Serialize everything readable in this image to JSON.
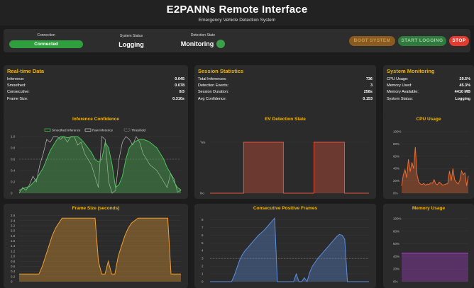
{
  "header": {
    "title": "E2PANNs Remote Interface",
    "subtitle": "Emergency Vehicle Detection System"
  },
  "topbar": {
    "connection_label": "Connection",
    "connection_value": "Connected",
    "system_status_label": "System Status",
    "system_status_value": "Logging",
    "detection_state_label": "Detection State",
    "detection_state_value": "Monitoring",
    "boot_label": "BOOT SYSTEM",
    "start_logging_label": "START LOGGING",
    "stop_label": "STOP"
  },
  "realtime": {
    "title": "Real-time Data",
    "rows": [
      {
        "label": "Inference:",
        "value": "0.045"
      },
      {
        "label": "Smoothed:",
        "value": "0.078"
      },
      {
        "label": "Consecutive:",
        "value": "0/3"
      },
      {
        "label": "Frame Size:",
        "value": "0.310s"
      }
    ]
  },
  "session": {
    "title": "Session Statistics",
    "rows": [
      {
        "label": "Total Inferences:",
        "value": "736"
      },
      {
        "label": "Detection Events:",
        "value": "3"
      },
      {
        "label": "Session Duration:",
        "value": "258s"
      },
      {
        "label": "Avg Confidence:",
        "value": "0.153"
      }
    ]
  },
  "system": {
    "title": "System Monitoring",
    "rows": [
      {
        "label": "CPU Usage:",
        "value": "29.5%"
      },
      {
        "label": "Memory Used:",
        "value": "45.3%"
      },
      {
        "label": "Memory Available:",
        "value": "4410 MB"
      },
      {
        "label": "System Status:",
        "value": "Logging"
      }
    ]
  },
  "colors": {
    "accent": "#f0b400",
    "green": "#3aa04a",
    "stop": "#e53b2e",
    "ev": "#e5533c",
    "frame": "#f0a030",
    "consec": "#5b8de0",
    "memory": "#b040d0",
    "cpu": "#ee6a2e"
  },
  "chart_data": [
    {
      "type": "line",
      "title": "Inference Confidence",
      "yticks": [
        "0",
        "0.2",
        "0.4",
        "0.6",
        "0.8",
        "1.0"
      ],
      "ylim": [
        0,
        1.05
      ],
      "threshold": 0.6,
      "series": [
        {
          "name": "Smoothed Inference",
          "values": [
            0.05,
            0.08,
            0.1,
            0.12,
            0.18,
            0.25,
            0.35,
            0.45,
            0.6,
            0.75,
            0.85,
            0.95,
            1.0,
            1.0,
            0.98,
            0.99,
            1.0,
            1.0,
            0.95,
            0.88,
            0.8,
            0.72,
            0.6,
            0.55,
            0.6,
            0.9,
            0.8,
            0.5,
            0.1,
            0.15,
            0.3,
            0.6,
            0.8,
            0.88,
            0.92,
            0.95,
            0.95,
            0.93,
            0.9,
            0.85,
            0.8,
            0.7,
            0.6,
            0.45,
            0.35,
            0.2,
            0.1,
            0.06
          ]
        },
        {
          "name": "Raw Inference",
          "values": [
            0.0,
            0.1,
            0.05,
            0.15,
            0.3,
            0.2,
            0.5,
            0.7,
            0.95,
            0.9,
            1.0,
            1.0,
            0.95,
            1.0,
            0.9,
            1.0,
            1.0,
            0.85,
            0.9,
            0.7,
            0.6,
            0.5,
            0.3,
            0.1,
            1.0,
            0.95,
            0.2,
            0.0,
            0.05,
            0.6,
            0.9,
            1.0,
            0.95,
            0.85,
            1.0,
            0.9,
            0.7,
            0.6,
            0.5,
            0.45,
            0.4,
            0.3,
            0.2,
            0.1,
            0.35,
            0.25,
            0.02,
            0.05
          ]
        },
        {
          "name": "Threshold",
          "values": []
        }
      ]
    },
    {
      "type": "area",
      "title": "EV Detection State",
      "yticks": [
        "No",
        "Yes"
      ],
      "values": [
        0,
        0,
        0,
        0,
        0,
        0,
        0,
        0,
        0,
        0,
        0,
        1,
        1,
        1,
        1,
        1,
        1,
        1,
        1,
        1,
        1,
        1,
        1,
        1,
        0,
        0,
        0,
        0,
        0,
        0,
        0,
        0,
        0,
        0,
        1,
        1,
        1,
        1,
        1,
        1,
        1,
        1,
        1,
        1,
        0,
        0,
        0,
        0,
        0,
        0,
        0,
        0,
        0
      ]
    },
    {
      "type": "area",
      "title": "CPU Usage",
      "yticks": [
        "0%",
        "20%",
        "40%",
        "60%",
        "80%",
        "100%"
      ],
      "ylim": [
        0,
        100
      ],
      "values": [
        12,
        30,
        38,
        25,
        55,
        35,
        50,
        40,
        75,
        30,
        18,
        15,
        14,
        16,
        13,
        15,
        14,
        17,
        16,
        22,
        15,
        14,
        18,
        16,
        13,
        14,
        15,
        16,
        36,
        20,
        40,
        22,
        18,
        15,
        20,
        36,
        30,
        33,
        12,
        28
      ]
    },
    {
      "type": "area",
      "title": "Frame Size (seconds)",
      "yticks": [
        "0",
        "0.2",
        "0.4",
        "0.6",
        "0.8",
        "1.0",
        "1.2",
        "1.4",
        "1.6",
        "1.8",
        "2.0",
        "2.2",
        "2.4",
        "2.6"
      ],
      "ylim": [
        0,
        2.7
      ],
      "values": [
        0.3,
        0.3,
        0.3,
        0.3,
        0.3,
        0.3,
        0.3,
        0.6,
        1.0,
        1.4,
        1.8,
        2.1,
        2.3,
        2.5,
        2.5,
        2.5,
        2.5,
        2.5,
        2.5,
        2.5,
        2.5,
        2.5,
        2.5,
        2.5,
        0.8,
        0.3,
        0.3,
        0.8,
        0.3,
        0.3,
        1.0,
        1.4,
        1.8,
        2.1,
        2.3,
        2.4,
        2.5,
        2.5,
        2.5,
        2.5,
        2.5,
        2.5,
        2.5,
        2.5,
        2.5,
        2.5,
        0.3,
        0.3,
        0.3,
        0.3
      ]
    },
    {
      "type": "area",
      "title": "Consecutive Positive Frames",
      "yticks": [
        "0",
        "1",
        "2",
        "3",
        "4",
        "5",
        "6",
        "7",
        "8"
      ],
      "ylim": [
        0,
        8.5
      ],
      "threshold": 3,
      "values": [
        0,
        0,
        0,
        0,
        0,
        0,
        0,
        0,
        0,
        0.8,
        1.8,
        2.8,
        3.5,
        4,
        4.4,
        4.8,
        5.2,
        5.6,
        6,
        6.3,
        6.6,
        7,
        7.4,
        7.8,
        8.2,
        0,
        0,
        0,
        0,
        0,
        0,
        0,
        1,
        0,
        0,
        0.5,
        0,
        1.2,
        2,
        2.5,
        3,
        3.4,
        3.8,
        4.2,
        4.6,
        5,
        5.4,
        5.8,
        6.1,
        6,
        5.5,
        0,
        0,
        0,
        0,
        0,
        0,
        0,
        0,
        0
      ]
    },
    {
      "type": "area",
      "title": "Memory Usage",
      "yticks": [
        "0%",
        "20%",
        "40%",
        "60%",
        "80%",
        "100%"
      ],
      "ylim": [
        0,
        100
      ],
      "values": [
        45,
        45,
        45,
        45,
        45,
        45,
        45,
        45,
        45,
        45,
        45,
        45,
        45,
        45,
        45,
        45,
        45,
        45,
        45,
        45
      ]
    }
  ]
}
